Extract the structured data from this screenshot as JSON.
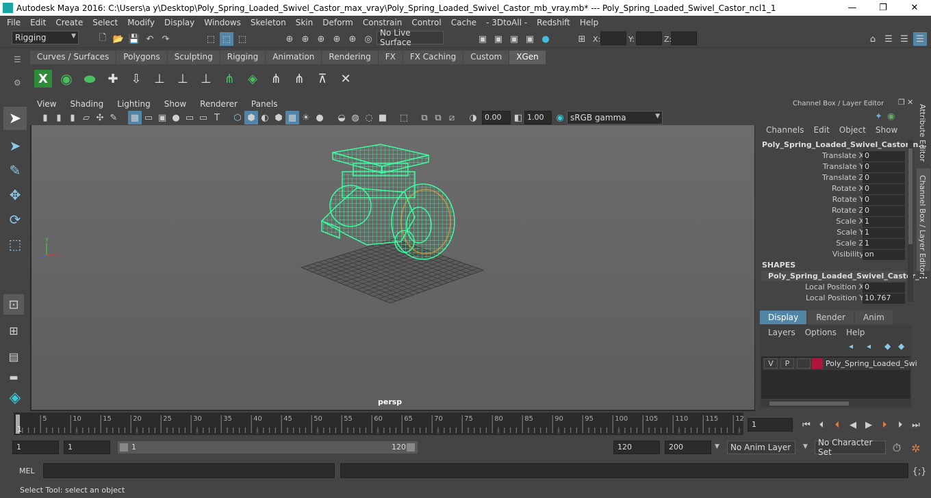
{
  "window": {
    "title": "Autodesk Maya 2016: C:\\Users\\a y\\Desktop\\Poly_Spring_Loaded_Swivel_Castor_max_vray\\Poly_Spring_Loaded_Swivel_Castor_mb_vray.mb*   ---   Poly_Spring_Loaded_Swivel_Castor_ncl1_1",
    "minimize": "—",
    "maximize": "❐",
    "close": "✕"
  },
  "menubar": [
    "File",
    "Edit",
    "Create",
    "Select",
    "Modify",
    "Display",
    "Windows",
    "Skeleton",
    "Skin",
    "Deform",
    "Constrain",
    "Control",
    "Cache",
    "- 3DtoAll -",
    "Redshift",
    "Help"
  ],
  "statusline": {
    "mode": "Rigging",
    "live_surface": "No Live Surface",
    "x_label": "X:",
    "y_label": "Y:",
    "z_label": "Z:"
  },
  "shelf_tabs": [
    "Curves / Surfaces",
    "Polygons",
    "Sculpting",
    "Rigging",
    "Animation",
    "Rendering",
    "FX",
    "FX Caching",
    "Custom",
    "XGen"
  ],
  "active_shelf_tab": "XGen",
  "viewport": {
    "menu": [
      "View",
      "Shading",
      "Lighting",
      "Show",
      "Renderer",
      "Panels"
    ],
    "exposure": "0.00",
    "gamma": "1.00",
    "color_space": "sRGB gamma",
    "camera_label": "persp"
  },
  "channel_box": {
    "panel_title": "Channel Box / Layer Editor",
    "menu": [
      "Channels",
      "Edit",
      "Object",
      "Show"
    ],
    "object_name": "Poly_Spring_Loaded_Swivel_Castor_n...",
    "attributes": [
      {
        "label": "Translate X",
        "value": "0"
      },
      {
        "label": "Translate Y",
        "value": "0"
      },
      {
        "label": "Translate Z",
        "value": "0"
      },
      {
        "label": "Rotate X",
        "value": "0"
      },
      {
        "label": "Rotate Y",
        "value": "0"
      },
      {
        "label": "Rotate Z",
        "value": "0"
      },
      {
        "label": "Scale X",
        "value": "1"
      },
      {
        "label": "Scale Y",
        "value": "1"
      },
      {
        "label": "Scale Z",
        "value": "1"
      },
      {
        "label": "Visibility",
        "value": "on"
      }
    ],
    "shapes_header": "SHAPES",
    "shape_name": "Poly_Spring_Loaded_Swivel_Castor_...",
    "shape_attributes": [
      {
        "label": "Local Position X",
        "value": "0"
      },
      {
        "label": "Local Position Y",
        "value": "10.767"
      }
    ]
  },
  "layer_editor": {
    "tabs": [
      "Display",
      "Render",
      "Anim"
    ],
    "active_tab": "Display",
    "menu": [
      "Layers",
      "Options",
      "Help"
    ],
    "layer": {
      "v": "V",
      "p": "P",
      "name": "Poly_Spring_Loaded_Swi",
      "color": "#b0153a"
    }
  },
  "side_tabs": [
    "Attribute Editor",
    "Channel Box / Layer Editor"
  ],
  "timeline": {
    "ticks": [
      "5",
      "10",
      "15",
      "20",
      "25",
      "30",
      "35",
      "40",
      "45",
      "50",
      "55",
      "60",
      "65",
      "70",
      "75",
      "80",
      "85",
      "90",
      "95",
      "100",
      "105",
      "110",
      "115",
      "12"
    ],
    "start_marker": "1",
    "current_frame": "1"
  },
  "range": {
    "start": "1",
    "playback_start": "1",
    "slider_start": "1",
    "slider_end": "120",
    "playback_end": "120",
    "end": "200",
    "anim_layer": "No Anim Layer",
    "character_set": "No Character Set"
  },
  "mel": {
    "label": "MEL"
  },
  "help_line": "Select Tool: select an object",
  "colors": {
    "wireframe": "#3dfca0",
    "selected_wire": "#e0a030",
    "grid": "#3a3a3a"
  }
}
